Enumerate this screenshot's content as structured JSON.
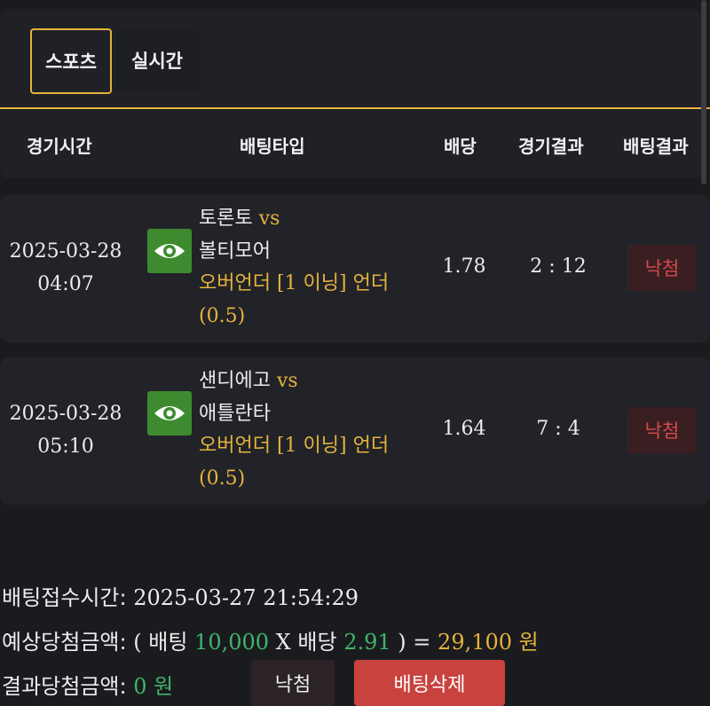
{
  "tabs": [
    {
      "label": "스포츠",
      "active": true
    },
    {
      "label": "실시간",
      "active": false
    }
  ],
  "columns": [
    "경기시간",
    "배팅타입",
    "배당",
    "경기결과",
    "배팅결과"
  ],
  "rows": [
    {
      "date": "2025-03-28",
      "time": "04:07",
      "home": "토론토",
      "vs": "vs",
      "away": "볼티모어",
      "market_prefix": "오버언더",
      "market_detail": "[1 이닝]",
      "market_pick": "언더",
      "market_line": "(0.5)",
      "odds": "1.78",
      "score": "2 : 12",
      "result": "낙첨"
    },
    {
      "date": "2025-03-28",
      "time": "05:10",
      "home": "샌디에고",
      "vs": "vs",
      "away": "애틀란타",
      "market_prefix": "오버언더",
      "market_detail": "[1 이닝]",
      "market_pick": "언더",
      "market_line": "(0.5)",
      "odds": "1.64",
      "score": "7 : 4",
      "result": "낙첨"
    }
  ],
  "summary": {
    "received_label": "배팅접수시간:",
    "received_value": "2025-03-27 21:54:29",
    "expected_label": "예상당첨금액:",
    "open_paren": "(",
    "bet_label": "배팅",
    "bet_amount": "10,000",
    "times": "X",
    "odds_label": "배당",
    "total_odds": "2.91",
    "close_paren": ") =",
    "expected_amount": "29,100",
    "won": "원",
    "result_label": "결과당첨금액:",
    "result_amount": "0",
    "result_won": "원"
  },
  "buttons": {
    "status_label": "낙첨",
    "delete_label": "배팅삭제"
  },
  "colors": {
    "accent_gold": "#e5b23c",
    "eye_green": "#3d8b2e",
    "lost_red": "#d84a4a",
    "delete_red": "#c8423e",
    "amount_green": "#3fb56a"
  }
}
